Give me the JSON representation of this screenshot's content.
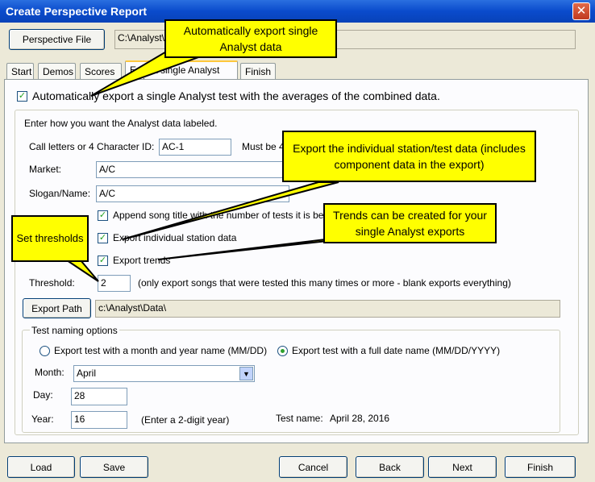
{
  "window": {
    "title": "Create Perspective Report",
    "close_glyph": "✕"
  },
  "perspective": {
    "button_label": "Perspective File",
    "path": "C:\\Analyst\\"
  },
  "tabs": [
    {
      "label": "Start"
    },
    {
      "label": "Demos"
    },
    {
      "label": "Scores"
    },
    {
      "label": "Export single Analyst test",
      "active": true
    },
    {
      "label": "Finish"
    }
  ],
  "auto_export": {
    "checked": true,
    "label": "Automatically export a single Analyst test with the averages of the combined data."
  },
  "form": {
    "intro": "Enter how you want the Analyst data labeled.",
    "call_letters_label": "Call letters or 4 Character ID:",
    "call_letters_value": "AC-1",
    "must_be": "Must be 4",
    "market_label": "Market:",
    "market_value": "A/C",
    "slogan_label": "Slogan/Name:",
    "slogan_value": "A/C",
    "append_label": "Append song title with the number of tests it is bein",
    "export_station_label": "Export individual station data",
    "export_trends_label": "Export trends",
    "threshold_label": "Threshold:",
    "threshold_value": "2",
    "threshold_note": "(only export songs that were tested this many times or more - blank exports everything)",
    "export_path_button": "Export Path",
    "export_path_value": "c:\\Analyst\\Data\\"
  },
  "naming": {
    "group_label": "Test naming options",
    "option_month_year": "Export test with a month and year name (MM/DD)",
    "option_full_date": "Export test with a full date name (MM/DD/YYYY)",
    "selected": "full_date",
    "month_label": "Month:",
    "month_value": "April",
    "day_label": "Day:",
    "day_value": "28",
    "year_label": "Year:",
    "year_value": "16",
    "year_hint": "(Enter a 2-digit year)",
    "test_name_label": "Test name:",
    "test_name_value": "April 28, 2016"
  },
  "buttons": {
    "load": "Load",
    "save": "Save",
    "cancel": "Cancel",
    "back": "Back",
    "next": "Next",
    "finish": "Finish"
  },
  "callouts": {
    "auto_export": "Automatically export single Analyst data",
    "station_data": "Export the individual station/test data (includes component data in the export)",
    "trends": "Trends can be created for your single Analyst exports",
    "thresholds": "Set thresholds"
  },
  "colors": {
    "callout_fill": "#ffff00",
    "title_bar": "#0a4bcc"
  }
}
